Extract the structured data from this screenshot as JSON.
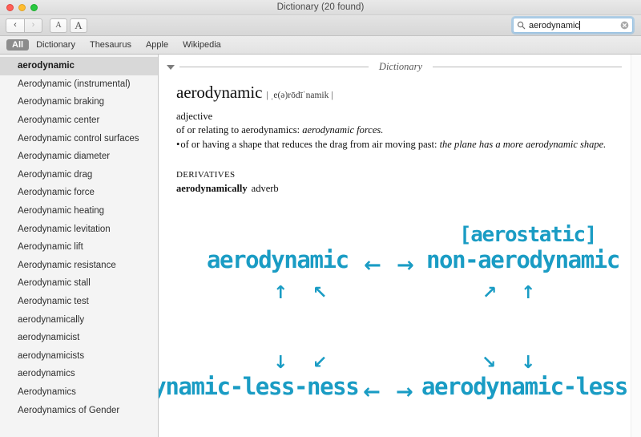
{
  "window": {
    "title": "Dictionary (20 found)",
    "traffic_lights": [
      "close",
      "minimize",
      "maximize"
    ]
  },
  "toolbar": {
    "back_label": "‹",
    "forward_label": "›",
    "font_small_label": "A",
    "font_large_label": "A",
    "search": {
      "value": "aerodynamic",
      "placeholder": "Search",
      "icon": "search-icon",
      "clear_icon": "clear-icon"
    }
  },
  "tabs": [
    {
      "label": "All",
      "active": true
    },
    {
      "label": "Dictionary",
      "active": false
    },
    {
      "label": "Thesaurus",
      "active": false
    },
    {
      "label": "Apple",
      "active": false
    },
    {
      "label": "Wikipedia",
      "active": false
    }
  ],
  "sidebar": {
    "items": [
      {
        "label": "aerodynamic",
        "selected": true
      },
      {
        "label": "Aerodynamic (instrumental)",
        "selected": false
      },
      {
        "label": "Aerodynamic braking",
        "selected": false
      },
      {
        "label": "Aerodynamic center",
        "selected": false
      },
      {
        "label": "Aerodynamic control surfaces",
        "selected": false
      },
      {
        "label": "Aerodynamic diameter",
        "selected": false
      },
      {
        "label": "Aerodynamic drag",
        "selected": false
      },
      {
        "label": "Aerodynamic force",
        "selected": false
      },
      {
        "label": "Aerodynamic heating",
        "selected": false
      },
      {
        "label": "Aerodynamic levitation",
        "selected": false
      },
      {
        "label": "Aerodynamic lift",
        "selected": false
      },
      {
        "label": "Aerodynamic resistance",
        "selected": false
      },
      {
        "label": "Aerodynamic stall",
        "selected": false
      },
      {
        "label": "Aerodynamic test",
        "selected": false
      },
      {
        "label": "aerodynamically",
        "selected": false
      },
      {
        "label": "aerodynamicist",
        "selected": false
      },
      {
        "label": "aerodynamicists",
        "selected": false
      },
      {
        "label": "aerodynamics",
        "selected": false
      },
      {
        "label": "Aerodynamics",
        "selected": false
      },
      {
        "label": "Aerodynamics of Gender",
        "selected": false
      }
    ]
  },
  "content": {
    "section_label": "Dictionary",
    "headword": "aerodynamic",
    "phonetic": "| ˌe(ə)rōdīˈnamik |",
    "part_of_speech": "adjective",
    "sense_1_text": "of or relating to aerodynamics: ",
    "sense_1_example": "aerodynamic forces.",
    "sense_2_bullet": "•",
    "sense_2_text": "of or having a shape that reduces the drag from air moving past: ",
    "sense_2_example": "the plane has a more aerodynamic shape.",
    "derivatives_heading": "DERIVATIVES",
    "derivative_word": "aerodynamically",
    "derivative_pos": "adverb"
  },
  "diagram": {
    "accent_color": "#1a9cc4",
    "nodes": [
      {
        "id": "aerostatic",
        "label": "[aerostatic]"
      },
      {
        "id": "aerodynamic",
        "label": "aerodynamic"
      },
      {
        "id": "non-aerodynamic",
        "label": "non-aerodynamic"
      },
      {
        "id": "aerodynamic-less-ness",
        "label": "aerodynamic-less-ness"
      },
      {
        "id": "aerodynamic-less",
        "label": "aerodynamic-less"
      }
    ],
    "arrows": [
      {
        "id": "mid-left",
        "glyph": "←"
      },
      {
        "id": "mid-right",
        "glyph": "→"
      },
      {
        "id": "left-up",
        "glyph": "↑"
      },
      {
        "id": "left-up-left",
        "glyph": "↖"
      },
      {
        "id": "right-up-right",
        "glyph": "↗"
      },
      {
        "id": "right-up",
        "glyph": "↑"
      },
      {
        "id": "lower-left-down",
        "glyph": "↓"
      },
      {
        "id": "lower-left-down-left",
        "glyph": "↙"
      },
      {
        "id": "lower-right-down-right",
        "glyph": "↘"
      },
      {
        "id": "lower-right-down",
        "glyph": "↓"
      },
      {
        "id": "bottom-left",
        "glyph": "←"
      },
      {
        "id": "bottom-right",
        "glyph": "→"
      }
    ]
  }
}
